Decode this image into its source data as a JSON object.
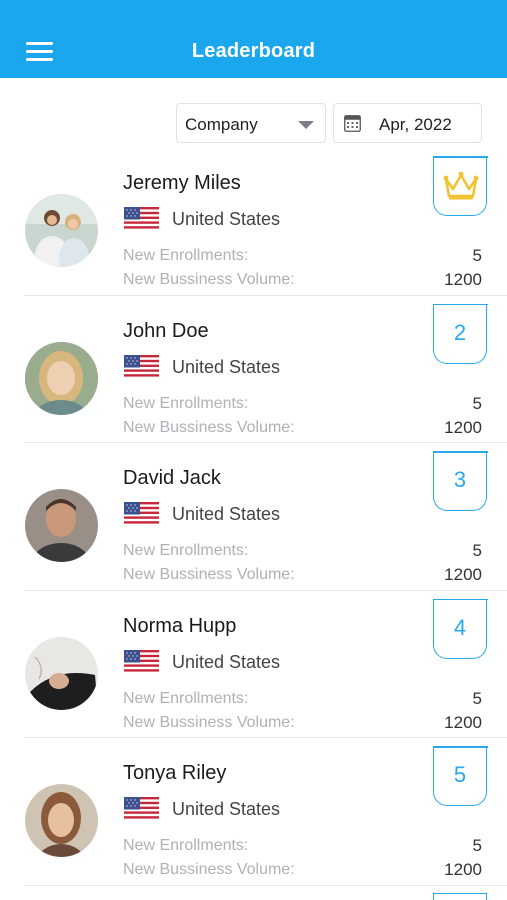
{
  "header": {
    "title": "Leaderboard",
    "menu_icon": "hamburger-menu-icon"
  },
  "filters": {
    "company": "Company",
    "date": "Apr, 2022"
  },
  "labels": {
    "enrollments": "New Enrollments:",
    "volume": "New Bussiness Volume:"
  },
  "rows": [
    {
      "name": "Jeremy Miles",
      "country": "United States",
      "enrollments": "5",
      "volume": "1200",
      "rank": "",
      "rank_icon": "crown-icon"
    },
    {
      "name": "John Doe",
      "country": "United States",
      "enrollments": "5",
      "volume": "1200",
      "rank": "2"
    },
    {
      "name": "David Jack",
      "country": "United States",
      "enrollments": "5",
      "volume": "1200",
      "rank": "3"
    },
    {
      "name": "Norma Hupp",
      "country": "United States",
      "enrollments": "5",
      "volume": "1200",
      "rank": "4"
    },
    {
      "name": "Tonya Riley",
      "country": "United States",
      "enrollments": "5",
      "volume": "1200",
      "rank": "5"
    }
  ],
  "colors": {
    "header": "#1aa7ee",
    "rank_accent": "#27a9ec",
    "crown": "#f2c230"
  }
}
